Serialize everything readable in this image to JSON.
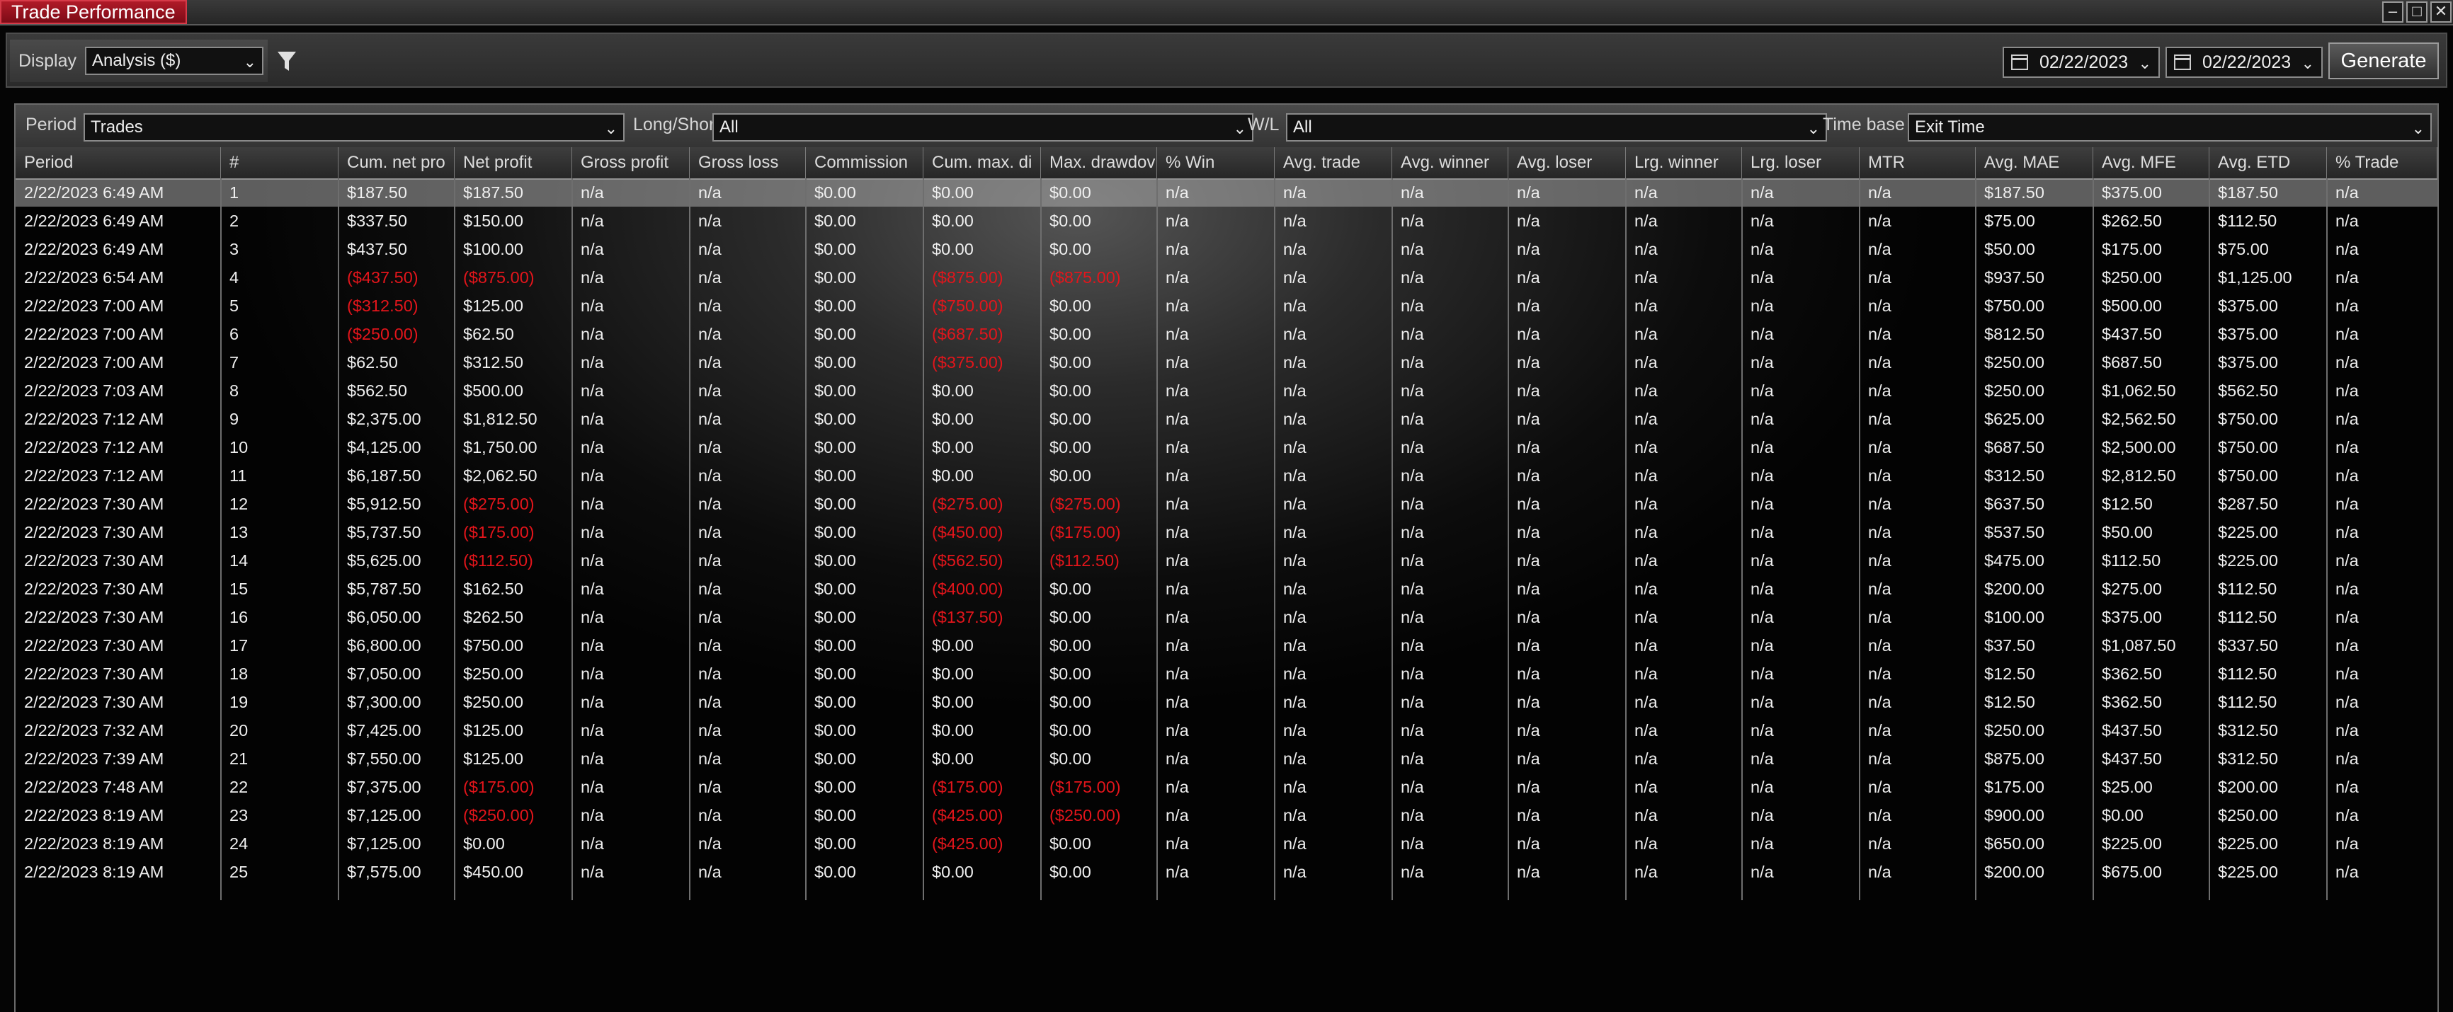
{
  "window": {
    "title": "Trade Performance"
  },
  "toolbar": {
    "display_label": "Display",
    "display_value": "Analysis ($)",
    "start_date": "02/22/2023",
    "end_date": "02/22/2023",
    "generate_label": "Generate"
  },
  "filters": {
    "period_label": "Period",
    "period_value": "Trades",
    "longshort_label": "Long/Short",
    "longshort_value": "All",
    "wl_label": "W/L",
    "wl_value": "All",
    "timebase_label": "Time base",
    "timebase_value": "Exit Time"
  },
  "colors": {
    "negative": "#e3151b",
    "accent": "#b01a28"
  },
  "columns": [
    "Period",
    "#",
    "Cum. net pro",
    "Net profit",
    "Gross profit",
    "Gross loss",
    "Commission",
    "Cum. max. di",
    "Max. drawdov",
    "% Win",
    "Avg. trade",
    "Avg. winner",
    "Avg. loser",
    "Lrg. winner",
    "Lrg. loser",
    "MTR",
    "Avg. MAE",
    "Avg. MFE",
    "Avg. ETD",
    "% Trade"
  ],
  "rows": [
    [
      "2/22/2023 6:49 AM",
      "1",
      "$187.50",
      "$187.50",
      "n/a",
      "n/a",
      "$0.00",
      "$0.00",
      "$0.00",
      "n/a",
      "n/a",
      "n/a",
      "n/a",
      "n/a",
      "n/a",
      "n/a",
      "$187.50",
      "$375.00",
      "$187.50",
      "n/a"
    ],
    [
      "2/22/2023 6:49 AM",
      "2",
      "$337.50",
      "$150.00",
      "n/a",
      "n/a",
      "$0.00",
      "$0.00",
      "$0.00",
      "n/a",
      "n/a",
      "n/a",
      "n/a",
      "n/a",
      "n/a",
      "n/a",
      "$75.00",
      "$262.50",
      "$112.50",
      "n/a"
    ],
    [
      "2/22/2023 6:49 AM",
      "3",
      "$437.50",
      "$100.00",
      "n/a",
      "n/a",
      "$0.00",
      "$0.00",
      "$0.00",
      "n/a",
      "n/a",
      "n/a",
      "n/a",
      "n/a",
      "n/a",
      "n/a",
      "$50.00",
      "$175.00",
      "$75.00",
      "n/a"
    ],
    [
      "2/22/2023 6:54 AM",
      "4",
      "($437.50)",
      "($875.00)",
      "n/a",
      "n/a",
      "$0.00",
      "($875.00)",
      "($875.00)",
      "n/a",
      "n/a",
      "n/a",
      "n/a",
      "n/a",
      "n/a",
      "n/a",
      "$937.50",
      "$250.00",
      "$1,125.00",
      "n/a"
    ],
    [
      "2/22/2023 7:00 AM",
      "5",
      "($312.50)",
      "$125.00",
      "n/a",
      "n/a",
      "$0.00",
      "($750.00)",
      "$0.00",
      "n/a",
      "n/a",
      "n/a",
      "n/a",
      "n/a",
      "n/a",
      "n/a",
      "$750.00",
      "$500.00",
      "$375.00",
      "n/a"
    ],
    [
      "2/22/2023 7:00 AM",
      "6",
      "($250.00)",
      "$62.50",
      "n/a",
      "n/a",
      "$0.00",
      "($687.50)",
      "$0.00",
      "n/a",
      "n/a",
      "n/a",
      "n/a",
      "n/a",
      "n/a",
      "n/a",
      "$812.50",
      "$437.50",
      "$375.00",
      "n/a"
    ],
    [
      "2/22/2023 7:00 AM",
      "7",
      "$62.50",
      "$312.50",
      "n/a",
      "n/a",
      "$0.00",
      "($375.00)",
      "$0.00",
      "n/a",
      "n/a",
      "n/a",
      "n/a",
      "n/a",
      "n/a",
      "n/a",
      "$250.00",
      "$687.50",
      "$375.00",
      "n/a"
    ],
    [
      "2/22/2023 7:03 AM",
      "8",
      "$562.50",
      "$500.00",
      "n/a",
      "n/a",
      "$0.00",
      "$0.00",
      "$0.00",
      "n/a",
      "n/a",
      "n/a",
      "n/a",
      "n/a",
      "n/a",
      "n/a",
      "$250.00",
      "$1,062.50",
      "$562.50",
      "n/a"
    ],
    [
      "2/22/2023 7:12 AM",
      "9",
      "$2,375.00",
      "$1,812.50",
      "n/a",
      "n/a",
      "$0.00",
      "$0.00",
      "$0.00",
      "n/a",
      "n/a",
      "n/a",
      "n/a",
      "n/a",
      "n/a",
      "n/a",
      "$625.00",
      "$2,562.50",
      "$750.00",
      "n/a"
    ],
    [
      "2/22/2023 7:12 AM",
      "10",
      "$4,125.00",
      "$1,750.00",
      "n/a",
      "n/a",
      "$0.00",
      "$0.00",
      "$0.00",
      "n/a",
      "n/a",
      "n/a",
      "n/a",
      "n/a",
      "n/a",
      "n/a",
      "$687.50",
      "$2,500.00",
      "$750.00",
      "n/a"
    ],
    [
      "2/22/2023 7:12 AM",
      "11",
      "$6,187.50",
      "$2,062.50",
      "n/a",
      "n/a",
      "$0.00",
      "$0.00",
      "$0.00",
      "n/a",
      "n/a",
      "n/a",
      "n/a",
      "n/a",
      "n/a",
      "n/a",
      "$312.50",
      "$2,812.50",
      "$750.00",
      "n/a"
    ],
    [
      "2/22/2023 7:30 AM",
      "12",
      "$5,912.50",
      "($275.00)",
      "n/a",
      "n/a",
      "$0.00",
      "($275.00)",
      "($275.00)",
      "n/a",
      "n/a",
      "n/a",
      "n/a",
      "n/a",
      "n/a",
      "n/a",
      "$637.50",
      "$12.50",
      "$287.50",
      "n/a"
    ],
    [
      "2/22/2023 7:30 AM",
      "13",
      "$5,737.50",
      "($175.00)",
      "n/a",
      "n/a",
      "$0.00",
      "($450.00)",
      "($175.00)",
      "n/a",
      "n/a",
      "n/a",
      "n/a",
      "n/a",
      "n/a",
      "n/a",
      "$537.50",
      "$50.00",
      "$225.00",
      "n/a"
    ],
    [
      "2/22/2023 7:30 AM",
      "14",
      "$5,625.00",
      "($112.50)",
      "n/a",
      "n/a",
      "$0.00",
      "($562.50)",
      "($112.50)",
      "n/a",
      "n/a",
      "n/a",
      "n/a",
      "n/a",
      "n/a",
      "n/a",
      "$475.00",
      "$112.50",
      "$225.00",
      "n/a"
    ],
    [
      "2/22/2023 7:30 AM",
      "15",
      "$5,787.50",
      "$162.50",
      "n/a",
      "n/a",
      "$0.00",
      "($400.00)",
      "$0.00",
      "n/a",
      "n/a",
      "n/a",
      "n/a",
      "n/a",
      "n/a",
      "n/a",
      "$200.00",
      "$275.00",
      "$112.50",
      "n/a"
    ],
    [
      "2/22/2023 7:30 AM",
      "16",
      "$6,050.00",
      "$262.50",
      "n/a",
      "n/a",
      "$0.00",
      "($137.50)",
      "$0.00",
      "n/a",
      "n/a",
      "n/a",
      "n/a",
      "n/a",
      "n/a",
      "n/a",
      "$100.00",
      "$375.00",
      "$112.50",
      "n/a"
    ],
    [
      "2/22/2023 7:30 AM",
      "17",
      "$6,800.00",
      "$750.00",
      "n/a",
      "n/a",
      "$0.00",
      "$0.00",
      "$0.00",
      "n/a",
      "n/a",
      "n/a",
      "n/a",
      "n/a",
      "n/a",
      "n/a",
      "$37.50",
      "$1,087.50",
      "$337.50",
      "n/a"
    ],
    [
      "2/22/2023 7:30 AM",
      "18",
      "$7,050.00",
      "$250.00",
      "n/a",
      "n/a",
      "$0.00",
      "$0.00",
      "$0.00",
      "n/a",
      "n/a",
      "n/a",
      "n/a",
      "n/a",
      "n/a",
      "n/a",
      "$12.50",
      "$362.50",
      "$112.50",
      "n/a"
    ],
    [
      "2/22/2023 7:30 AM",
      "19",
      "$7,300.00",
      "$250.00",
      "n/a",
      "n/a",
      "$0.00",
      "$0.00",
      "$0.00",
      "n/a",
      "n/a",
      "n/a",
      "n/a",
      "n/a",
      "n/a",
      "n/a",
      "$12.50",
      "$362.50",
      "$112.50",
      "n/a"
    ],
    [
      "2/22/2023 7:32 AM",
      "20",
      "$7,425.00",
      "$125.00",
      "n/a",
      "n/a",
      "$0.00",
      "$0.00",
      "$0.00",
      "n/a",
      "n/a",
      "n/a",
      "n/a",
      "n/a",
      "n/a",
      "n/a",
      "$250.00",
      "$437.50",
      "$312.50",
      "n/a"
    ],
    [
      "2/22/2023 7:39 AM",
      "21",
      "$7,550.00",
      "$125.00",
      "n/a",
      "n/a",
      "$0.00",
      "$0.00",
      "$0.00",
      "n/a",
      "n/a",
      "n/a",
      "n/a",
      "n/a",
      "n/a",
      "n/a",
      "$875.00",
      "$437.50",
      "$312.50",
      "n/a"
    ],
    [
      "2/22/2023 7:48 AM",
      "22",
      "$7,375.00",
      "($175.00)",
      "n/a",
      "n/a",
      "$0.00",
      "($175.00)",
      "($175.00)",
      "n/a",
      "n/a",
      "n/a",
      "n/a",
      "n/a",
      "n/a",
      "n/a",
      "$175.00",
      "$25.00",
      "$200.00",
      "n/a"
    ],
    [
      "2/22/2023 8:19 AM",
      "23",
      "$7,125.00",
      "($250.00)",
      "n/a",
      "n/a",
      "$0.00",
      "($425.00)",
      "($250.00)",
      "n/a",
      "n/a",
      "n/a",
      "n/a",
      "n/a",
      "n/a",
      "n/a",
      "$900.00",
      "$0.00",
      "$250.00",
      "n/a"
    ],
    [
      "2/22/2023 8:19 AM",
      "24",
      "$7,125.00",
      "$0.00",
      "n/a",
      "n/a",
      "$0.00",
      "($425.00)",
      "$0.00",
      "n/a",
      "n/a",
      "n/a",
      "n/a",
      "n/a",
      "n/a",
      "n/a",
      "$650.00",
      "$225.00",
      "$225.00",
      "n/a"
    ],
    [
      "2/22/2023 8:19 AM",
      "25",
      "$7,575.00",
      "$450.00",
      "n/a",
      "n/a",
      "$0.00",
      "$0.00",
      "$0.00",
      "n/a",
      "n/a",
      "n/a",
      "n/a",
      "n/a",
      "n/a",
      "n/a",
      "$200.00",
      "$675.00",
      "$225.00",
      "n/a"
    ]
  ],
  "selected_row": 0
}
